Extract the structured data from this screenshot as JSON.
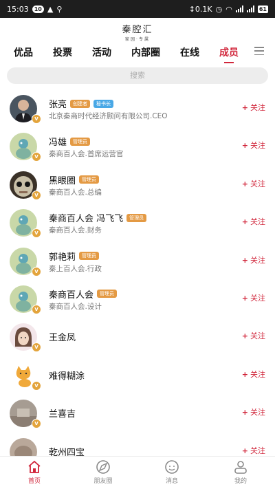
{
  "status_bar": {
    "time": "15:03",
    "badge": "10",
    "net_speed": "0.1K",
    "battery": "61"
  },
  "logo": {
    "main": "秦腔汇",
    "sub": "家园·专属"
  },
  "tabs": [
    {
      "label": "优品",
      "active": false
    },
    {
      "label": "投票",
      "active": false
    },
    {
      "label": "活动",
      "active": false
    },
    {
      "label": "内部圈",
      "active": false
    },
    {
      "label": "在线",
      "active": false
    },
    {
      "label": "成员",
      "active": true
    }
  ],
  "search": {
    "placeholder": "搜索"
  },
  "follow_label": "关注",
  "members": [
    {
      "name": "张亮",
      "badges": [
        {
          "text": "创建者",
          "color": "orange"
        },
        {
          "text": "秘书长",
          "color": "blue"
        }
      ],
      "sub": "北京秦商时代经济顾问有限公司.CEO",
      "avatar": "man-in-suit"
    },
    {
      "name": "冯雄",
      "badges": [
        {
          "text": "管理员",
          "color": "orange"
        }
      ],
      "sub": "秦商百人会.首席运营官",
      "avatar": "default-bird"
    },
    {
      "name": "黑眼圈",
      "badges": [
        {
          "text": "管理员",
          "color": "orange"
        }
      ],
      "sub": "秦商百人会.总编",
      "avatar": "doll-face"
    },
    {
      "name": "秦商百人会 冯飞飞",
      "badges": [
        {
          "text": "管理员",
          "color": "orange"
        }
      ],
      "sub": "秦商百人会.财务",
      "avatar": "default-bird"
    },
    {
      "name": "郭艳莉",
      "badges": [
        {
          "text": "管理员",
          "color": "orange"
        }
      ],
      "sub": "秦上百人会.行政",
      "avatar": "default-bird"
    },
    {
      "name": "秦商百人会",
      "badges": [
        {
          "text": "管理员",
          "color": "orange"
        }
      ],
      "sub": "秦商百人会.设计",
      "avatar": "default-bird"
    },
    {
      "name": "王金凤",
      "badges": [],
      "sub": "",
      "avatar": "cartoon-girl"
    },
    {
      "name": "难得糊涂",
      "badges": [],
      "sub": "",
      "avatar": "cartoon-cat"
    },
    {
      "name": "兰喜吉",
      "badges": [],
      "sub": "",
      "avatar": "photo-sign"
    },
    {
      "name": "乾州四宝",
      "badges": [],
      "sub": "",
      "avatar": "photo-blur"
    }
  ],
  "bottom_nav": [
    {
      "label": "首页",
      "icon": "home-icon",
      "active": true
    },
    {
      "label": "朋友圈",
      "icon": "compass-icon",
      "active": false
    },
    {
      "label": "消息",
      "icon": "message-icon",
      "active": false
    },
    {
      "label": "我的",
      "icon": "profile-icon",
      "active": false
    }
  ],
  "colors": {
    "accent": "#d1263b",
    "badge_orange": "#e49a44",
    "badge_blue": "#49a8e6",
    "verified": "#e3a43c"
  }
}
